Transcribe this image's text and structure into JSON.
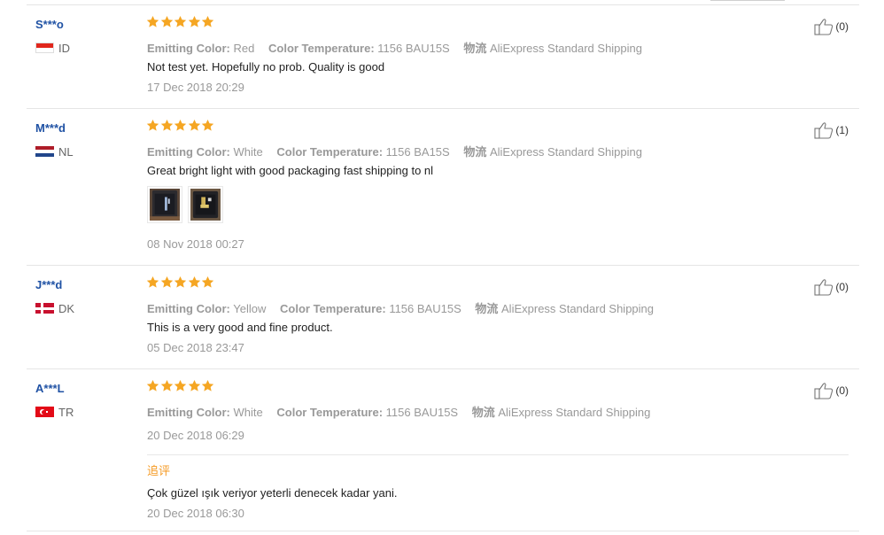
{
  "labels": {
    "emitting_color": "Emitting Color:",
    "color_temperature": "Color Temperature:",
    "logistics": "物流",
    "additional_feedback": "追评"
  },
  "colors": {
    "star": "#f5a623",
    "user_link": "#2052a4",
    "additional_label": "#f59a23"
  },
  "reviews": [
    {
      "user": "S***o",
      "country": "ID",
      "flag_icon": "indonesia-flag-icon",
      "rating": 5,
      "emitting_color": "Red",
      "color_temperature": "1156 BAU15S",
      "shipping": "AliExpress Standard Shipping",
      "text": "Not test yet. Hopefully no prob. Quality is good",
      "date": "17 Dec 2018 20:29",
      "helpful": "(0)"
    },
    {
      "user": "M***d",
      "country": "NL",
      "flag_icon": "netherlands-flag-icon",
      "rating": 5,
      "emitting_color": "White",
      "color_temperature": "1156 BA15S",
      "shipping": "AliExpress Standard Shipping",
      "text": "Great bright light with good packaging fast shipping to nl",
      "date": "08 Nov 2018 00:27",
      "helpful": "(1)",
      "photos": [
        "photo-1",
        "photo-2"
      ]
    },
    {
      "user": "J***d",
      "country": "DK",
      "flag_icon": "denmark-flag-icon",
      "rating": 5,
      "emitting_color": "Yellow",
      "color_temperature": "1156 BAU15S",
      "shipping": "AliExpress Standard Shipping",
      "text": "This is a very good and fine product.",
      "date": "05 Dec 2018 23:47",
      "helpful": "(0)"
    },
    {
      "user": "A***L",
      "country": "TR",
      "flag_icon": "turkey-flag-icon",
      "rating": 5,
      "emitting_color": "White",
      "color_temperature": "1156 BAU15S",
      "shipping": "AliExpress Standard Shipping",
      "date": "20 Dec 2018 06:29",
      "helpful": "(0)",
      "additional_text": "Çok güzel ışık veriyor yeterli denecek kadar yani.",
      "additional_date": "20 Dec 2018 06:30"
    }
  ]
}
